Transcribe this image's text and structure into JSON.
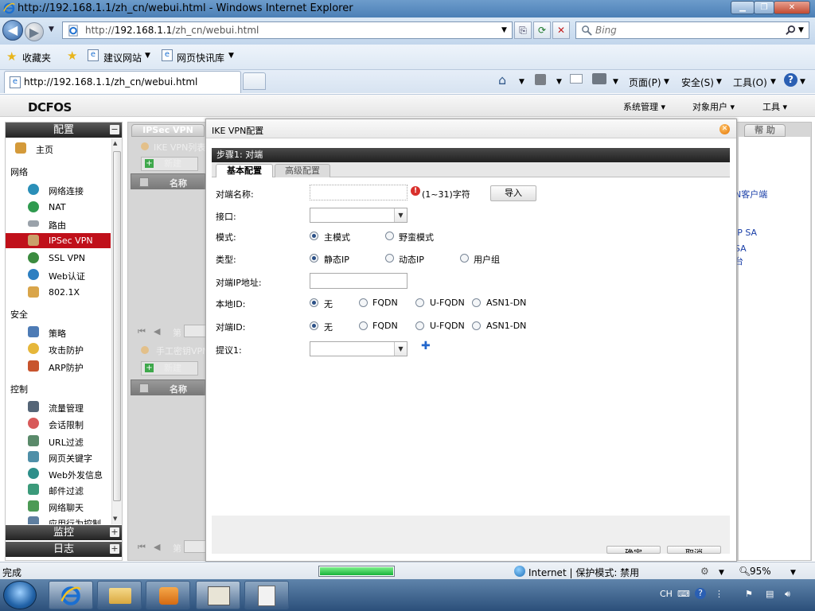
{
  "window": {
    "title": "http://192.168.1.1/zh_cn/webui.html - Windows Internet Explorer",
    "min_btn": "▁",
    "max_btn": "❐",
    "close_btn": "✕"
  },
  "address": {
    "url_prefix": "http://",
    "url_host": "192.168.1.1",
    "url_path": "/zh_cn/webui.html",
    "search_placeholder": "Bing"
  },
  "favorites": {
    "favorites_label": "收藏夹",
    "suggested_sites": "建议网站",
    "web_slice_gallery": "网页快讯库"
  },
  "tabs": {
    "active_tab": "http://192.168.1.1/zh_cn/webui.html"
  },
  "commandbar": {
    "page": "页面(P)",
    "safety": "安全(S)",
    "tools": "工具(O)"
  },
  "app": {
    "logo": "DCFOS",
    "menu_system": "系统管理",
    "menu_objects": "对象用户",
    "menu_tools": "工具"
  },
  "nav": {
    "header_config": "配置",
    "header_monitor": "监控",
    "header_log": "日志",
    "home": "主页",
    "group_network": "网络",
    "network_items": [
      "网络连接",
      "NAT",
      "路由",
      "IPSec VPN",
      "SSL VPN",
      "Web认证",
      "802.1X"
    ],
    "group_security": "安全",
    "security_items": [
      "策略",
      "攻击防护",
      "ARP防护"
    ],
    "group_control": "控制",
    "control_items": [
      "流量管理",
      "会话限制",
      "URL过滤",
      "网页关键字",
      "Web外发信息",
      "邮件过滤",
      "网络聊天",
      "应用行为控制"
    ],
    "plus": "+",
    "minus": "−"
  },
  "background": {
    "tab_ipsec": "IPSec VPN",
    "tab_help": "帮 助",
    "ike_list": "IKE VPN列表",
    "manual_key": "手工密钥VPN",
    "new_btn": "新建",
    "col_name": "名称",
    "page_label": "第",
    "right_links": [
      "N客户端",
      "IP SA",
      "SA",
      "台"
    ]
  },
  "dialog": {
    "title": "IKE VPN配置",
    "step": "步骤1: 对端",
    "tab_basic": "基本配置",
    "tab_advanced": "高级配置",
    "peer_name_label": "对端名称:",
    "peer_name_value": "",
    "peer_name_hint": "(1~31)字符",
    "import_btn": "导入",
    "interface_label": "接口:",
    "interface_value": "",
    "mode_label": "模式:",
    "mode_main": "主模式",
    "mode_aggressive": "野蛮模式",
    "type_label": "类型:",
    "type_static": "静态IP",
    "type_dynamic": "动态IP",
    "type_usergroup": "用户组",
    "peer_ip_label": "对端IP地址:",
    "peer_ip_value": "",
    "local_id_label": "本地ID:",
    "peer_id_label": "对端ID:",
    "id_none": "无",
    "id_fqdn": "FQDN",
    "id_ufqdn": "U-FQDN",
    "id_asn1": "ASN1-DN",
    "proposal_label": "提议1:",
    "proposal_value": "",
    "ok_btn": "确定",
    "cancel_btn": "取消"
  },
  "status": {
    "left": "完成",
    "progress": 1.0,
    "zone": "Internet | 保护模式: 禁用",
    "zoom": "95%"
  },
  "taskbar": {
    "lang": "CH"
  }
}
